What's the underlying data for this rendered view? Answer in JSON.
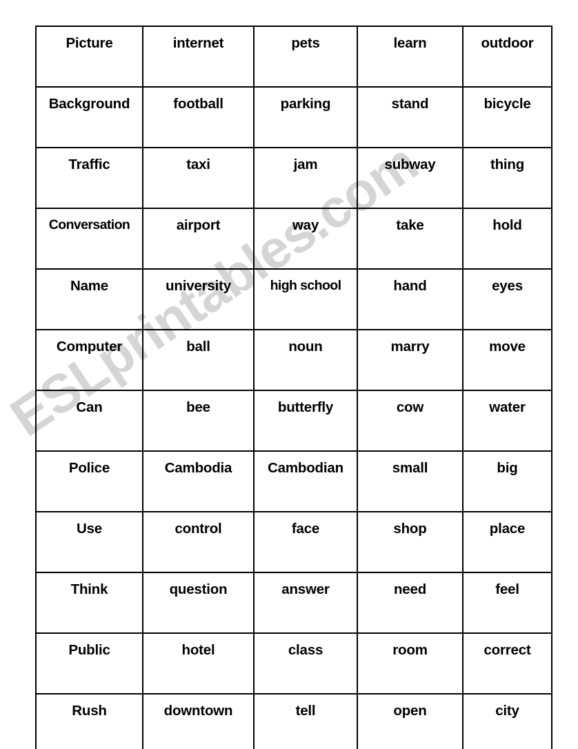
{
  "document": {
    "type": "vocabulary-word-card-grid",
    "columns": 5,
    "rows": 12,
    "text_color": "#000000",
    "background_color": "#ffffff",
    "border_color": "#000000"
  },
  "watermark": {
    "text": "ESLprintables.com",
    "color": "#969696",
    "rotation_deg": -34
  },
  "grid": {
    "rows": [
      {
        "cells": [
          "Picture",
          "internet",
          "pets",
          "learn",
          "outdoor"
        ]
      },
      {
        "cells": [
          "Background",
          "football",
          "parking",
          "stand",
          "bicycle"
        ]
      },
      {
        "cells": [
          "Traffic",
          "taxi",
          "jam",
          "subway",
          "thing"
        ]
      },
      {
        "cells": [
          "Conversation",
          "airport",
          "way",
          "take",
          "hold"
        ]
      },
      {
        "cells": [
          "Name",
          "university",
          "high school",
          "hand",
          "eyes"
        ]
      },
      {
        "cells": [
          "Computer",
          "ball",
          "noun",
          "marry",
          "move"
        ]
      },
      {
        "cells": [
          "Can",
          "bee",
          "butterfly",
          "cow",
          "water"
        ]
      },
      {
        "cells": [
          "Police",
          "Cambodia",
          "Cambodian",
          "small",
          "big"
        ]
      },
      {
        "cells": [
          "Use",
          "control",
          "face",
          "shop",
          "place"
        ]
      },
      {
        "cells": [
          "Think",
          "question",
          "answer",
          "need",
          "feel"
        ]
      },
      {
        "cells": [
          "Public",
          "hotel",
          "class",
          "room",
          "correct"
        ]
      },
      {
        "cells": [
          "Rush",
          "downtown",
          "tell",
          "open",
          "city"
        ]
      }
    ]
  }
}
